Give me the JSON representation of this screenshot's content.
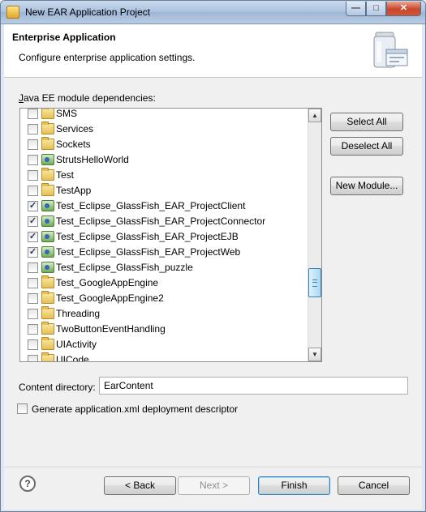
{
  "window": {
    "title": "New EAR Application Project"
  },
  "header": {
    "title": "Enterprise Application",
    "description": "Configure enterprise application settings."
  },
  "modules": {
    "label": "Java EE module dependencies:",
    "items": [
      {
        "label": "SMS",
        "checked": false,
        "icon": "folder-icon"
      },
      {
        "label": "Services",
        "checked": false,
        "icon": "folder-icon"
      },
      {
        "label": "Sockets",
        "checked": false,
        "icon": "folder-icon"
      },
      {
        "label": "StrutsHelloWorld",
        "checked": false,
        "icon": "ear-project-icon"
      },
      {
        "label": "Test",
        "checked": false,
        "icon": "folder-icon"
      },
      {
        "label": "TestApp",
        "checked": false,
        "icon": "folder-icon"
      },
      {
        "label": "Test_Eclipse_GlassFish_EAR_ProjectClient",
        "checked": true,
        "icon": "ear-project-icon"
      },
      {
        "label": "Test_Eclipse_GlassFish_EAR_ProjectConnector",
        "checked": true,
        "icon": "ear-project-icon"
      },
      {
        "label": "Test_Eclipse_GlassFish_EAR_ProjectEJB",
        "checked": true,
        "icon": "ear-project-icon"
      },
      {
        "label": "Test_Eclipse_GlassFish_EAR_ProjectWeb",
        "checked": true,
        "icon": "ear-project-icon"
      },
      {
        "label": "Test_Eclipse_GlassFish_puzzle",
        "checked": false,
        "icon": "ear-project-icon"
      },
      {
        "label": "Test_GoogleAppEngine",
        "checked": false,
        "icon": "folder-icon"
      },
      {
        "label": "Test_GoogleAppEngine2",
        "checked": false,
        "icon": "folder-icon"
      },
      {
        "label": "Threading",
        "checked": false,
        "icon": "folder-icon"
      },
      {
        "label": "TwoButtonEventHandling",
        "checked": false,
        "icon": "folder-icon"
      },
      {
        "label": "UIActivity",
        "checked": false,
        "icon": "folder-icon"
      },
      {
        "label": "UICode",
        "checked": false,
        "icon": "folder-icon"
      }
    ],
    "select_all": "Select All",
    "deselect_all": "Deselect All",
    "new_module": "New Module..."
  },
  "content_directory": {
    "label": "Content directory:",
    "value": "EarContent"
  },
  "generate_descriptor": {
    "label": "Generate application.xml deployment descriptor",
    "checked": false
  },
  "footer": {
    "help": "?",
    "back": "< Back",
    "next": "Next >",
    "finish": "Finish",
    "cancel": "Cancel"
  },
  "colors": {
    "title_bar": "#aac1de",
    "close_button": "#c9462c",
    "scroll_thumb": "#a9d8f2"
  }
}
